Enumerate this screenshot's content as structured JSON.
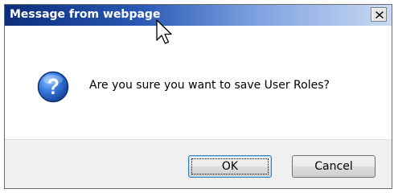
{
  "window": {
    "title": "Message from webpage"
  },
  "message": {
    "text": "Are you sure you want to save User Roles?",
    "icon": "question-icon"
  },
  "buttons": {
    "ok_label": "OK",
    "cancel_label": "Cancel"
  },
  "colors": {
    "titlebar_start": "#0b2d7a",
    "titlebar_end": "#c9d9f2",
    "icon_blue": "#2f6ccb",
    "footer_bg": "#f0f0f0"
  }
}
